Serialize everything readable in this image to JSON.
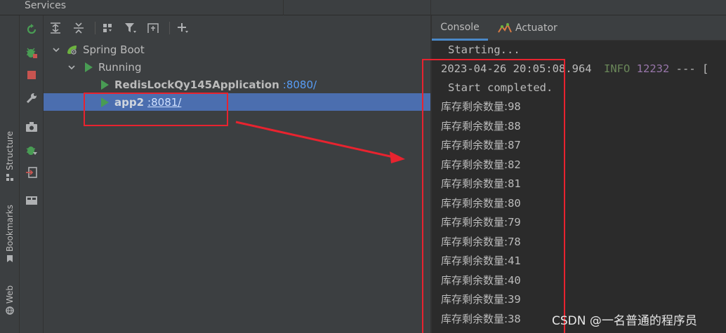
{
  "window": {
    "title": "Services"
  },
  "sidebar": {
    "tabs": [
      {
        "label": "Structure",
        "icon": "structure-icon"
      },
      {
        "label": "Bookmarks",
        "icon": "bookmark-icon"
      },
      {
        "label": "Web",
        "icon": "globe-icon"
      }
    ]
  },
  "actions": [
    {
      "name": "rerun-icon"
    },
    {
      "name": "debug-icon"
    },
    {
      "name": "stop-icon"
    },
    {
      "name": "wrench-icon"
    },
    {
      "name": "camera-icon"
    },
    {
      "name": "debug-attach-icon"
    },
    {
      "name": "exit-icon"
    },
    {
      "name": "layout-icon"
    }
  ],
  "toolbar": {
    "buttons": [
      "expand-all-icon",
      "collapse-all-icon",
      "group-by-icon",
      "filter-icon",
      "new-tab-icon",
      "add-icon"
    ]
  },
  "tree": {
    "root": {
      "label": "Spring Boot"
    },
    "group": {
      "label": "Running"
    },
    "apps": [
      {
        "name": "RedisLockQy145Application",
        "port": ":8080/",
        "selected": false
      },
      {
        "name": "app2",
        "port": ":8081/",
        "selected": true
      }
    ]
  },
  "console": {
    "tabs": [
      {
        "label": "Console",
        "active": true
      },
      {
        "label": "Actuator",
        "active": false
      }
    ],
    "lines": {
      "starting": "Starting...",
      "log_date": "2023-04-26 20:05:08.964",
      "log_level": "INFO",
      "log_pid": "12232",
      "log_rest": "--- [",
      "completed": "Start completed.",
      "stock_label": "库存剩余数量:",
      "stock_values": [
        "98",
        "88",
        "87",
        "82",
        "81",
        "80",
        "79",
        "78",
        "41",
        "40",
        "39",
        "38"
      ]
    }
  },
  "watermark": "CSDN @一名普通的程序员",
  "colors": {
    "panel": "#3c3f41",
    "editor": "#2b2b2b",
    "selection": "#4b6eaf",
    "run_green": "#499c54",
    "link": "#589df6",
    "annotation_red": "#e8232f",
    "info": "#6a8759",
    "pid": "#9876aa"
  }
}
